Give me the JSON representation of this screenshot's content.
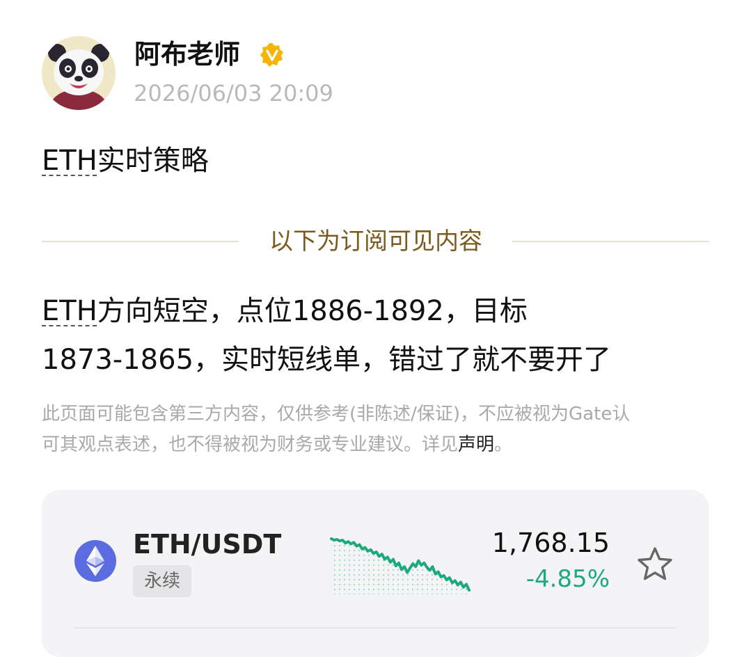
{
  "author": {
    "name": "阿布老师",
    "verified_icon": "verified-badge-icon",
    "avatar_icon": "panda-avatar",
    "timestamp": "2026/06/03 20:09"
  },
  "post": {
    "title_ticker": "ETH",
    "title_rest": "实时策略",
    "divider_text": "以下为订阅可见内容",
    "body_ticker": "ETH",
    "body_line1_rest": "方向短空，点位1886-1892，目标",
    "body_line2": "1873-1865，实时短线单，错过了就不要开了"
  },
  "disclaimer": {
    "line1": "此页面可能包含第三方内容，仅供参考(非陈述/保证)，不应被视为Gate认",
    "line2_before": "可其观点表述，也不得被视为财务或专业建议。详见",
    "link": "声明",
    "line2_after": "。"
  },
  "market_card": {
    "coin_icon": "ethereum-icon",
    "symbol": "ETH/USDT",
    "badge": "永续",
    "price": "1,768.15",
    "change": "-4.85%",
    "colors": {
      "down": "#1ea97c",
      "coin_bg": "#5b6be0"
    },
    "star_icon": "star-outline-icon",
    "sparkline": [
      10,
      12,
      11,
      13,
      12,
      16,
      14,
      17,
      15,
      20,
      18,
      24,
      22,
      27,
      25,
      30,
      28,
      34,
      31,
      38,
      35,
      42,
      38,
      47,
      43,
      52,
      48,
      56,
      50,
      44,
      48,
      40,
      46,
      43,
      49,
      53,
      48,
      58,
      55,
      62,
      60,
      66,
      63,
      70,
      67,
      73,
      69,
      76,
      72,
      80
    ]
  }
}
